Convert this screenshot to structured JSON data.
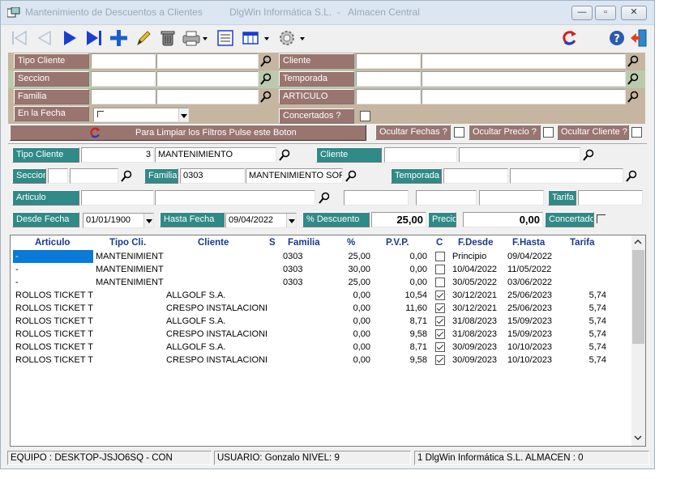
{
  "window": {
    "title": "Mantenimiento de Descuentos a Clientes          DlgWin Informática S.L.  -   Almacen Central",
    "minimize": "—",
    "maximize": "▫",
    "close": "✕"
  },
  "toolbar": {
    "icons": [
      "first-icon",
      "prev-icon",
      "next-icon",
      "last-icon",
      "add-icon",
      "edit-icon",
      "delete-icon",
      "print-icon",
      "export-icon",
      "grid-icon",
      "settings-icon",
      "refresh-icon",
      "help-icon",
      "exit-icon"
    ],
    "colors": {
      "nav_blue": "#1a3fd0",
      "add_blue": "#1a5fd0",
      "refresh_red": "#d02020"
    }
  },
  "filters": {
    "tipo_cliente": {
      "label": "Tipo Cliente",
      "code": "",
      "name": ""
    },
    "cliente": {
      "label": "Cliente",
      "code": "",
      "name": ""
    },
    "seccion": {
      "label": "Seccion",
      "code": "",
      "name": ""
    },
    "temporada": {
      "label": "Temporada",
      "code": "",
      "name": ""
    },
    "familia": {
      "label": "Familia",
      "code": "",
      "name": ""
    },
    "articulo": {
      "label": "ARTICULO",
      "code": "",
      "name": ""
    },
    "en_la_fecha": {
      "label": "En la Fecha",
      "value": ""
    },
    "concertados": {
      "label": "Concertados ?"
    },
    "clear_button": "Para Limpiar los Filtros Pulse este Boton",
    "ocultar_fechas": "Ocultar Fechas ?",
    "ocultar_precio": "Ocultar Precio ?",
    "ocultar_cliente": "Ocultar Cliente ?",
    "colors": {
      "label_bg": "#9a7570",
      "band_bg": "#c6b5a0",
      "band_green": "#bcc9ae"
    }
  },
  "detail": {
    "tipo_cliente": {
      "label": "Tipo Cliente",
      "code": "3",
      "name": "MANTENIMIENTO"
    },
    "cliente": {
      "label": "Cliente",
      "code": "",
      "name": ""
    },
    "seccion": {
      "label": "Seccion",
      "code": "",
      "name": ""
    },
    "familia": {
      "label": "Familia",
      "code": "0303",
      "name": "MANTENIMIENTO SOF"
    },
    "temporada": {
      "label": "Temporada",
      "code": "",
      "name": ""
    },
    "articulo": {
      "label": "Articulo",
      "code": "",
      "name": ""
    },
    "tarifa": {
      "label": "Tarifa",
      "value": ""
    },
    "desde_fecha": {
      "label": "Desde Fecha",
      "value": "01/01/1900"
    },
    "hasta_fecha": {
      "label": "Hasta Fecha",
      "value": "09/04/2022"
    },
    "descuento": {
      "label": "% Descuento",
      "value": "25,00"
    },
    "precio": {
      "label": "Precio",
      "value": "0,00"
    },
    "concertado": {
      "label": "Concertado"
    },
    "colors": {
      "label_bg": "#2f8a88"
    }
  },
  "grid": {
    "headers": [
      "Articulo",
      "Tipo Cli.",
      "Cliente",
      "S",
      "Familia",
      "%",
      "P.V.P.",
      "C",
      "F.Desde",
      "F.Hasta",
      "Tarifa"
    ],
    "rows": [
      {
        "articulo": "-",
        "tipo": "MANTENIMIENT",
        "cliente": "",
        "s": "",
        "familia": "0303",
        "pct": "25,00",
        "pvp": "0,00",
        "c": false,
        "desde": "Principio",
        "hasta": "09/04/2022",
        "tarifa": "",
        "selected": true
      },
      {
        "articulo": "-",
        "tipo": "MANTENIMIENT",
        "cliente": "",
        "s": "",
        "familia": "0303",
        "pct": "30,00",
        "pvp": "0,00",
        "c": false,
        "desde": "10/04/2022",
        "hasta": "11/05/2022",
        "tarifa": ""
      },
      {
        "articulo": "-",
        "tipo": "MANTENIMIENT",
        "cliente": "",
        "s": "",
        "familia": "0303",
        "pct": "25,00",
        "pvp": "0,00",
        "c": false,
        "desde": "30/05/2022",
        "hasta": "03/06/2022",
        "tarifa": ""
      },
      {
        "articulo": "ROLLOS TICKET TI",
        "tipo": "",
        "cliente": "ALLGOLF S.A.",
        "s": "",
        "familia": "",
        "pct": "0,00",
        "pvp": "10,54",
        "c": true,
        "desde": "30/12/2021",
        "hasta": "25/06/2023",
        "tarifa": "5,74"
      },
      {
        "articulo": "ROLLOS TICKET TI",
        "tipo": "",
        "cliente": "CRESPO INSTALACIONI",
        "s": "",
        "familia": "",
        "pct": "0,00",
        "pvp": "11,60",
        "c": true,
        "desde": "30/12/2021",
        "hasta": "25/06/2023",
        "tarifa": "5,74"
      },
      {
        "articulo": "ROLLOS TICKET TI",
        "tipo": "",
        "cliente": "ALLGOLF S.A.",
        "s": "",
        "familia": "",
        "pct": "0,00",
        "pvp": "8,71",
        "c": true,
        "desde": "31/08/2023",
        "hasta": "15/09/2023",
        "tarifa": "5,74"
      },
      {
        "articulo": "ROLLOS TICKET TI",
        "tipo": "",
        "cliente": "CRESPO INSTALACIONI",
        "s": "",
        "familia": "",
        "pct": "0,00",
        "pvp": "9,58",
        "c": true,
        "desde": "31/08/2023",
        "hasta": "15/09/2023",
        "tarifa": "5,74"
      },
      {
        "articulo": "ROLLOS TICKET TI",
        "tipo": "",
        "cliente": "ALLGOLF S.A.",
        "s": "",
        "familia": "",
        "pct": "0,00",
        "pvp": "8,71",
        "c": true,
        "desde": "30/09/2023",
        "hasta": "10/10/2023",
        "tarifa": "5,74"
      },
      {
        "articulo": "ROLLOS TICKET TI",
        "tipo": "",
        "cliente": "CRESPO INSTALACIONI",
        "s": "",
        "familia": "",
        "pct": "0,00",
        "pvp": "9,58",
        "c": true,
        "desde": "30/09/2023",
        "hasta": "10/10/2023",
        "tarifa": "5,74"
      }
    ],
    "colors": {
      "header_text": "#1a3a8a",
      "selected_bg": "#0a7ad8"
    }
  },
  "statusbar": {
    "equipo": "EQUIPO : DESKTOP-JSJO6SQ - CON",
    "usuario": "USUARIO: Gonzalo   NIVEL: 9",
    "empresa": "1 DlgWin Informática S.L.  ALMACEN : 0"
  }
}
